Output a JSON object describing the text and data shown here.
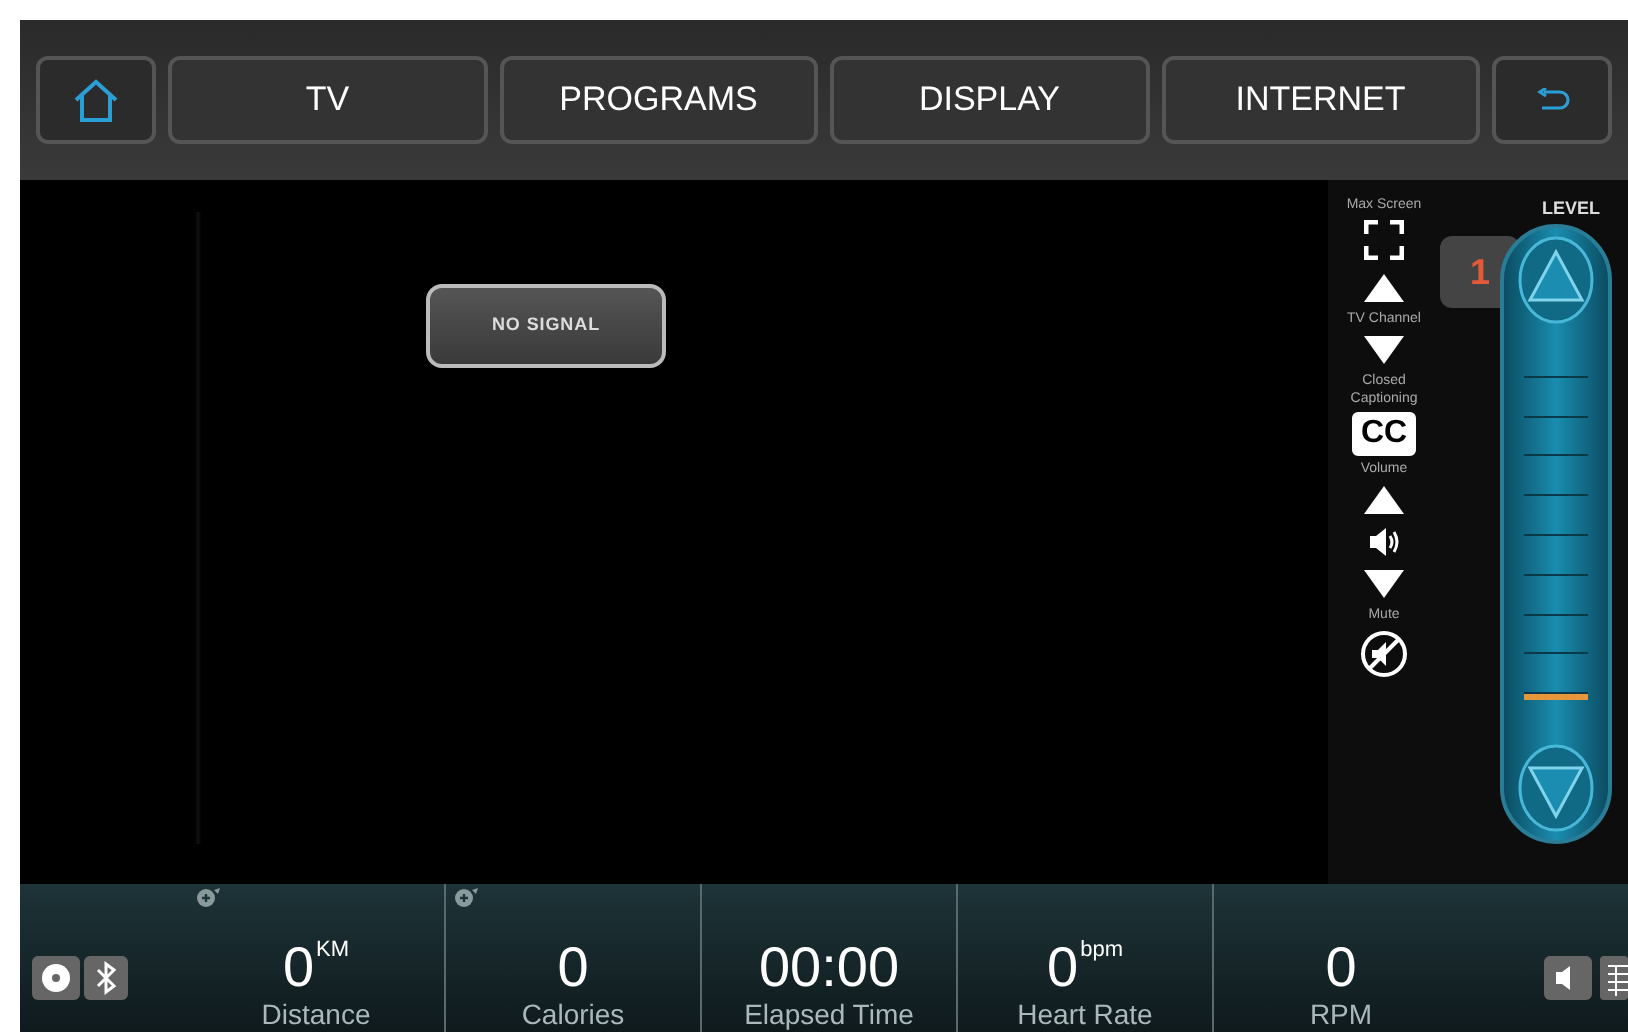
{
  "nav": {
    "tabs": [
      {
        "label": "TV",
        "selected": false
      },
      {
        "label": "PROGRAMS",
        "selected": false
      },
      {
        "label": "DISPLAY",
        "selected": false
      },
      {
        "label": "INTERNET",
        "selected": false
      }
    ]
  },
  "video": {
    "message": "NO SIGNAL"
  },
  "tv_controls": [
    {
      "kind": "fullscreen",
      "label": "Max Screen"
    },
    {
      "kind": "channel",
      "label": "TV Channel"
    },
    {
      "kind": "cc",
      "label": "Closed Captioning",
      "button": "CC"
    },
    {
      "kind": "volume",
      "label": "Volume"
    },
    {
      "kind": "mute",
      "label": "Mute"
    }
  ],
  "level_control": {
    "title": "LEVEL",
    "value": "1"
  },
  "stats": [
    {
      "value": "0",
      "unit": "KM",
      "label": "Distance",
      "editable": true
    },
    {
      "value": "0",
      "label": "Calories",
      "editable": true
    },
    {
      "value": "00:00",
      "label": "Elapsed Time",
      "editable": false
    },
    {
      "value": "0",
      "unit": "bpm",
      "label": "Heart Rate",
      "editable": false
    },
    {
      "value": "0",
      "label": "RPM",
      "editable": false
    }
  ]
}
